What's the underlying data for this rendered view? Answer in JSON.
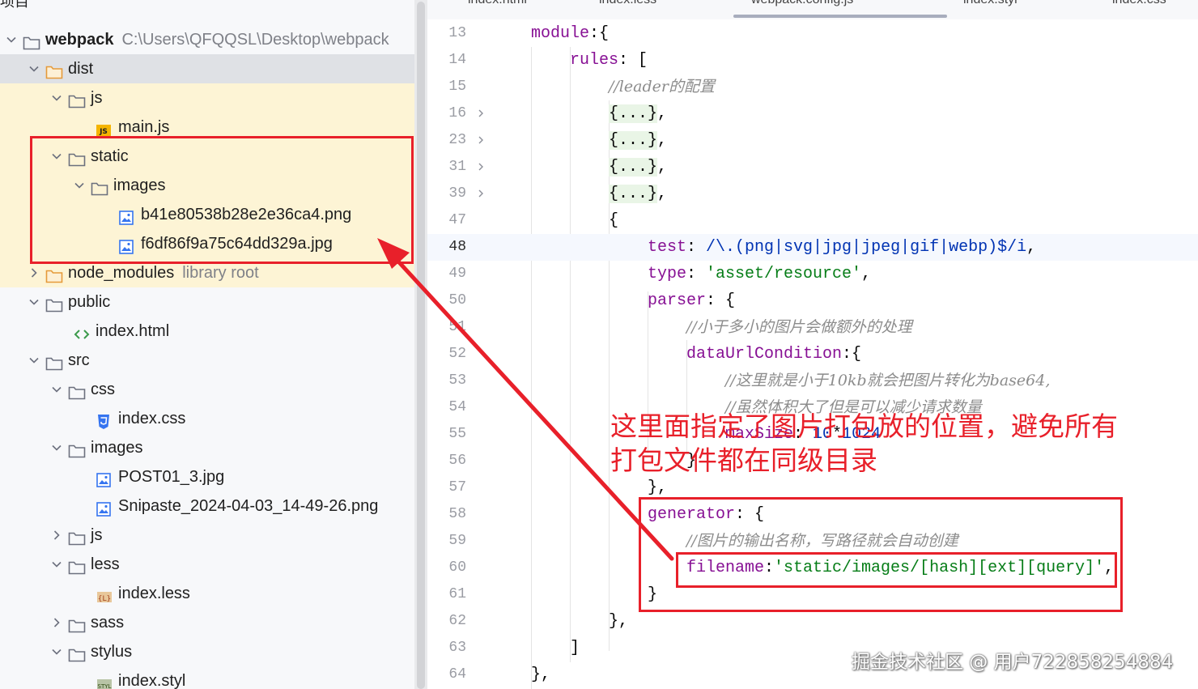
{
  "tree": {
    "top_cut_label": "项目",
    "rows": [
      {
        "label": "webpack",
        "path": "C:\\Users\\QFQQSL\\Desktop\\webpack",
        "type": "folder",
        "expanded": true,
        "bold": true
      },
      {
        "label": "dist",
        "type": "folder",
        "expanded": true
      },
      {
        "label": "js",
        "type": "folder",
        "expanded": true
      },
      {
        "label": "main.js",
        "type": "js-file"
      },
      {
        "label": "static",
        "type": "folder",
        "expanded": true
      },
      {
        "label": "images",
        "type": "folder",
        "expanded": true
      },
      {
        "label": "b41e80538b28e2e36ca4.png",
        "type": "image-file"
      },
      {
        "label": "f6df86f9a75c64dd329a.jpg",
        "type": "image-file"
      },
      {
        "label": "node_modules",
        "path": "library root",
        "type": "folder",
        "expanded": false
      },
      {
        "label": "public",
        "type": "folder",
        "expanded": true
      },
      {
        "label": "index.html",
        "type": "html-file"
      },
      {
        "label": "src",
        "type": "folder",
        "expanded": true
      },
      {
        "label": "css",
        "type": "folder",
        "expanded": true
      },
      {
        "label": "index.css",
        "type": "css-file"
      },
      {
        "label": "images",
        "type": "folder",
        "expanded": true
      },
      {
        "label": "POST01_3.jpg",
        "type": "image-file"
      },
      {
        "label": "Snipaste_2024-04-03_14-49-26.png",
        "type": "image-file"
      },
      {
        "label": "js",
        "type": "folder",
        "expanded": false
      },
      {
        "label": "less",
        "type": "folder",
        "expanded": true
      },
      {
        "label": "index.less",
        "type": "less-file"
      },
      {
        "label": "sass",
        "type": "folder",
        "expanded": false
      },
      {
        "label": "stylus",
        "type": "folder",
        "expanded": true
      },
      {
        "label": "index.styl",
        "type": "styl-file"
      }
    ]
  },
  "editor": {
    "tabs": [
      {
        "label": "index.html"
      },
      {
        "label": "index.less"
      },
      {
        "label": "webpack.config.js",
        "active": true
      },
      {
        "label": "index.styl"
      },
      {
        "label": "index.css"
      }
    ],
    "current_line": "48",
    "lines": [
      {
        "n": "13",
        "segs": [
          [
            "k",
            "module"
          ],
          [
            "",
            "    :{"
          ]
        ]
      },
      {
        "n": "14",
        "segs": [
          [
            "k",
            "rules"
          ],
          [
            "",
            ": ["
          ]
        ]
      },
      {
        "n": "15",
        "segs": [
          [
            "c",
            "//leader的配置"
          ]
        ]
      },
      {
        "n": "16",
        "fold": true,
        "segs": [
          [
            "fb",
            "{...}"
          ],
          [
            "",
            ","
          ]
        ]
      },
      {
        "n": "23",
        "fold": true,
        "segs": [
          [
            "fb",
            "{...}"
          ],
          [
            "",
            ","
          ]
        ]
      },
      {
        "n": "31",
        "fold": true,
        "segs": [
          [
            "fb",
            "{...}"
          ],
          [
            "",
            ","
          ]
        ]
      },
      {
        "n": "39",
        "fold": true,
        "segs": [
          [
            "fb",
            "{...}"
          ],
          [
            "",
            ","
          ]
        ]
      },
      {
        "n": "47",
        "segs": [
          [
            "",
            "{"
          ]
        ]
      },
      {
        "n": "48",
        "segs": [
          [
            "k",
            "test"
          ],
          [
            "",
            ": "
          ],
          [
            "p",
            "/\\.(png|svg|jpg|jpeg|gif|webp)$/i"
          ],
          [
            "",
            ","
          ]
        ]
      },
      {
        "n": "49",
        "segs": [
          [
            "k",
            "type"
          ],
          [
            "",
            ": "
          ],
          [
            "s",
            "'asset/resource'"
          ],
          [
            "",
            ","
          ]
        ]
      },
      {
        "n": "50",
        "segs": [
          [
            "k",
            "parser"
          ],
          [
            "",
            ": {"
          ]
        ]
      },
      {
        "n": "51",
        "segs": [
          [
            "c",
            "//小于多小的图片会做额外的处理"
          ]
        ]
      },
      {
        "n": "52",
        "segs": [
          [
            "k",
            "dataUrlCondition"
          ],
          [
            "",
            ":{"
          ]
        ]
      },
      {
        "n": "53",
        "segs": [
          [
            "c",
            "//这里就是小于10kb就会把图片转化为base64,"
          ]
        ]
      },
      {
        "n": "54",
        "segs": [
          [
            "c",
            "//虽然体积大了但是可以减少请求数量"
          ]
        ]
      },
      {
        "n": "55",
        "segs": [
          [
            "k",
            "maxSize"
          ],
          [
            "",
            ": "
          ],
          [
            "p",
            "10"
          ],
          [
            "",
            "*"
          ],
          [
            "p",
            "1024"
          ]
        ]
      },
      {
        "n": "56",
        "segs": [
          [
            "",
            "}"
          ]
        ]
      },
      {
        "n": "57",
        "segs": [
          [
            "",
            "},"
          ]
        ]
      },
      {
        "n": "58",
        "segs": [
          [
            "k",
            "generator"
          ],
          [
            "",
            ": {"
          ]
        ]
      },
      {
        "n": "59",
        "segs": [
          [
            "c",
            "//图片的输出名称，写路径就会自动创建"
          ]
        ]
      },
      {
        "n": "60",
        "segs": [
          [
            "k",
            "filename"
          ],
          [
            "",
            ":"
          ],
          [
            "s",
            "'static/images/[hash][ext][query]'"
          ],
          [
            "",
            ","
          ]
        ]
      },
      {
        "n": "61",
        "segs": [
          [
            "",
            "}"
          ]
        ]
      },
      {
        "n": "62",
        "segs": [
          [
            "",
            "},"
          ]
        ]
      },
      {
        "n": "63",
        "segs": [
          [
            "",
            "]"
          ]
        ]
      },
      {
        "n": "64",
        "segs": [
          [
            "",
            "},"
          ]
        ]
      }
    ]
  },
  "annotation": {
    "line1": "这里面指定了图片打包放的位置，避免所有",
    "line2": "打包文件都在同级目录",
    "color": "#e8202a"
  },
  "watermark": "掘金技术社区 @ 用户722858254884"
}
